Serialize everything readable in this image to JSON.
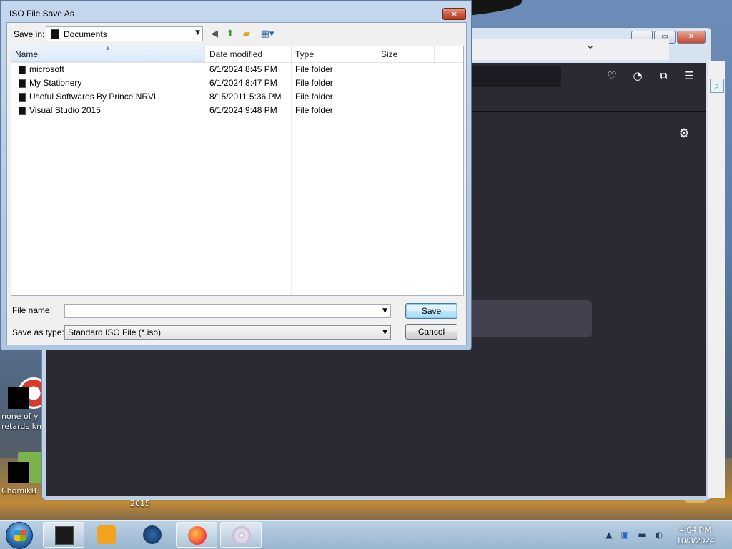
{
  "dialog": {
    "title": "ISO File Save As",
    "close_label": "×",
    "save_in_label": "Save in:",
    "save_in_value": "Documents",
    "columns": [
      "Name",
      "Date modified",
      "Type",
      "Size"
    ],
    "files": [
      {
        "name": "microsoft",
        "date": "6/1/2024 8:45 PM",
        "type": "File folder",
        "size": ""
      },
      {
        "name": "My Stationery",
        "date": "6/1/2024 8:47 PM",
        "type": "File folder",
        "size": ""
      },
      {
        "name": "Useful Softwares By Prince NRVL",
        "date": "8/15/2011 5:36 PM",
        "type": "File folder",
        "size": ""
      },
      {
        "name": "Visual Studio 2015",
        "date": "6/1/2024 9:48 PM",
        "type": "File folder",
        "size": ""
      }
    ],
    "file_name_label": "File name:",
    "file_name_value": "",
    "save_as_type_label": "Save as type:",
    "save_as_type_value": "Standard ISO File (*.iso)",
    "save_button": "Save",
    "cancel_button": "Cancel"
  },
  "desktop": {
    "icons": [
      {
        "label": "none of y retards kn"
      },
      {
        "label": "ChomikB"
      }
    ],
    "partial_label": "2015"
  },
  "taskbar": {
    "clock_time": "4:04 PM",
    "clock_date": "10/3/2024"
  },
  "colors": {
    "accent": "#3c7fb1",
    "firefox_dark": "#2b2a33",
    "status_led": "#27d04a"
  }
}
